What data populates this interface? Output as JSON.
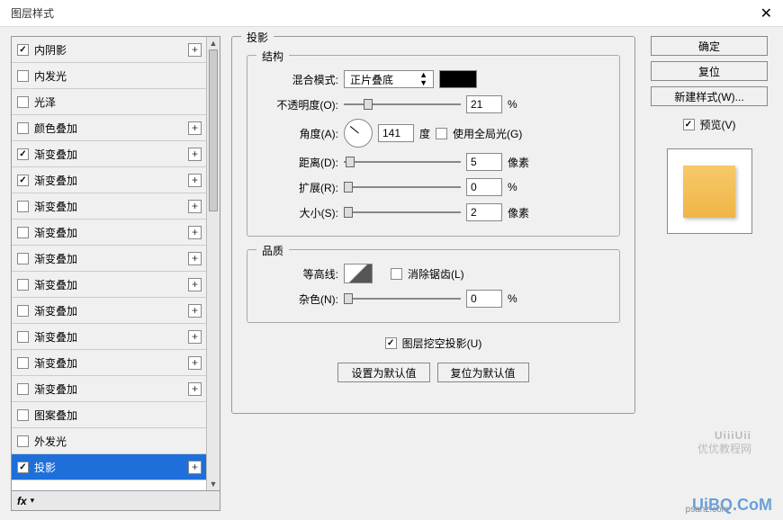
{
  "titlebar": {
    "title": "图层样式",
    "close": "✕"
  },
  "styles": [
    {
      "label": "内阴影",
      "checked": true,
      "plus": true
    },
    {
      "label": "内发光",
      "checked": false,
      "plus": false
    },
    {
      "label": "光泽",
      "checked": false,
      "plus": false
    },
    {
      "label": "颜色叠加",
      "checked": false,
      "plus": true
    },
    {
      "label": "渐变叠加",
      "checked": true,
      "plus": true
    },
    {
      "label": "渐变叠加",
      "checked": true,
      "plus": true
    },
    {
      "label": "渐变叠加",
      "checked": false,
      "plus": true
    },
    {
      "label": "渐变叠加",
      "checked": false,
      "plus": true
    },
    {
      "label": "渐变叠加",
      "checked": false,
      "plus": true
    },
    {
      "label": "渐变叠加",
      "checked": false,
      "plus": true
    },
    {
      "label": "渐变叠加",
      "checked": false,
      "plus": true
    },
    {
      "label": "渐变叠加",
      "checked": false,
      "plus": true
    },
    {
      "label": "渐变叠加",
      "checked": false,
      "plus": true
    },
    {
      "label": "渐变叠加",
      "checked": false,
      "plus": true
    },
    {
      "label": "图案叠加",
      "checked": false,
      "plus": false
    },
    {
      "label": "外发光",
      "checked": false,
      "plus": false
    },
    {
      "label": "投影",
      "checked": true,
      "plus": true,
      "selected": true
    }
  ],
  "bottombar": {
    "fx": "fx"
  },
  "panel": {
    "title": "投影",
    "structure": {
      "title": "结构",
      "blendmode_label": "混合模式:",
      "blendmode_value": "正片叠底",
      "opacity_label": "不透明度(O):",
      "opacity_value": "21",
      "opacity_unit": "%",
      "angle_label": "角度(A):",
      "angle_value": "141",
      "angle_unit": "度",
      "global_light": "使用全局光(G)",
      "distance_label": "距离(D):",
      "distance_value": "5",
      "distance_unit": "像素",
      "spread_label": "扩展(R):",
      "spread_value": "0",
      "spread_unit": "%",
      "size_label": "大小(S):",
      "size_value": "2",
      "size_unit": "像素"
    },
    "quality": {
      "title": "品质",
      "contour_label": "等高线:",
      "anti_alias": "消除锯齿(L)",
      "noise_label": "杂色(N):",
      "noise_value": "0",
      "noise_unit": "%"
    },
    "knockout": "图层挖空投影(U)",
    "btn_default": "设置为默认值",
    "btn_reset": "复位为默认值"
  },
  "right": {
    "ok": "确定",
    "cancel": "复位",
    "newstyle": "新建样式(W)...",
    "preview": "预览(V)"
  },
  "watermarks": {
    "w1a": "UiiiUii",
    "w1b": "优优教程网",
    "w2": "UiBQ.CoM",
    "w3": "psanz.com"
  }
}
